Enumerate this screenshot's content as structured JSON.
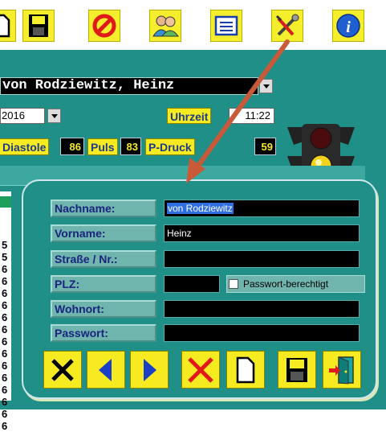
{
  "toolbar": {
    "icons": [
      "document-icon",
      "save-icon",
      "no-entry-icon",
      "people-icon",
      "form-list-icon",
      "tools-icon",
      "info-icon"
    ]
  },
  "patient": {
    "name": "von Rodziewitz, Heinz",
    "date_partial": "2016",
    "time_label": "Uhrzeit",
    "time_value": "11:22"
  },
  "vitals": {
    "diastole_label": "Diastole",
    "diastole_value": "86",
    "puls_label": "Puls",
    "puls_value": "83",
    "pdruck_label": "P-Druck",
    "pdruck_value": "59"
  },
  "left_column_digits": [
    "5",
    "5",
    "6",
    "6",
    "6",
    "6",
    "6",
    "6",
    "6",
    "6",
    "6",
    "6",
    "6",
    "6",
    "6",
    "6"
  ],
  "dialog": {
    "fields": [
      {
        "label": "Nachname:",
        "value": "von Rodziewitz"
      },
      {
        "label": "Vorname:",
        "value": "Heinz"
      },
      {
        "label": "Straße / Nr.:",
        "value": ""
      },
      {
        "label": "PLZ:",
        "value": ""
      },
      {
        "label": "Wohnort:",
        "value": ""
      },
      {
        "label": "Passwort:",
        "value": ""
      }
    ],
    "checkbox_label": "Passwort-berechtigt",
    "checkbox_checked": false,
    "buttons": [
      "close-icon",
      "previous-icon",
      "next-icon",
      "delete-icon",
      "new-document-icon",
      "save-icon",
      "exit-door-icon"
    ]
  },
  "colors": {
    "teal": "#1f8f87",
    "yellow": "#f6ea21",
    "label_text": "#1a237e",
    "arrow": "#c85a3a"
  }
}
